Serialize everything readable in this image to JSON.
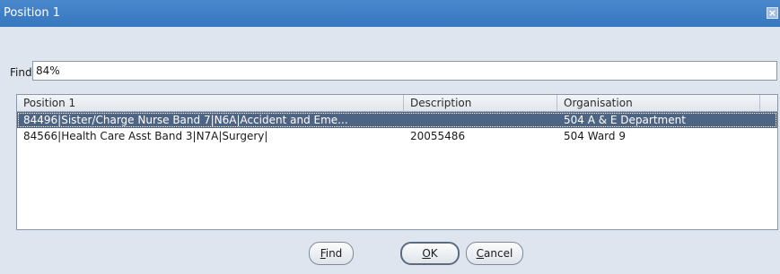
{
  "window": {
    "title": "Position 1",
    "close_label": "×"
  },
  "search": {
    "label": "Find",
    "value": "84%"
  },
  "table": {
    "columns": [
      "Position 1",
      "Description",
      "Organisation"
    ],
    "rows": [
      {
        "position": "84496|Sister/Charge Nurse Band 7|N6A|Accident and Eme...",
        "description": "",
        "organisation": "504 A & E Department",
        "selected": true
      },
      {
        "position": "84566|Health Care Asst Band 3|N7A|Surgery|",
        "description": "20055486",
        "organisation": "504 Ward 9",
        "selected": false
      }
    ]
  },
  "buttons": {
    "find_label": "Find",
    "ok_label": "OK",
    "cancel_label": "Cancel"
  },
  "colors": {
    "titlebar": "#3c7ec4",
    "background": "#dfe5ef",
    "selected_row": "#4e6485"
  }
}
